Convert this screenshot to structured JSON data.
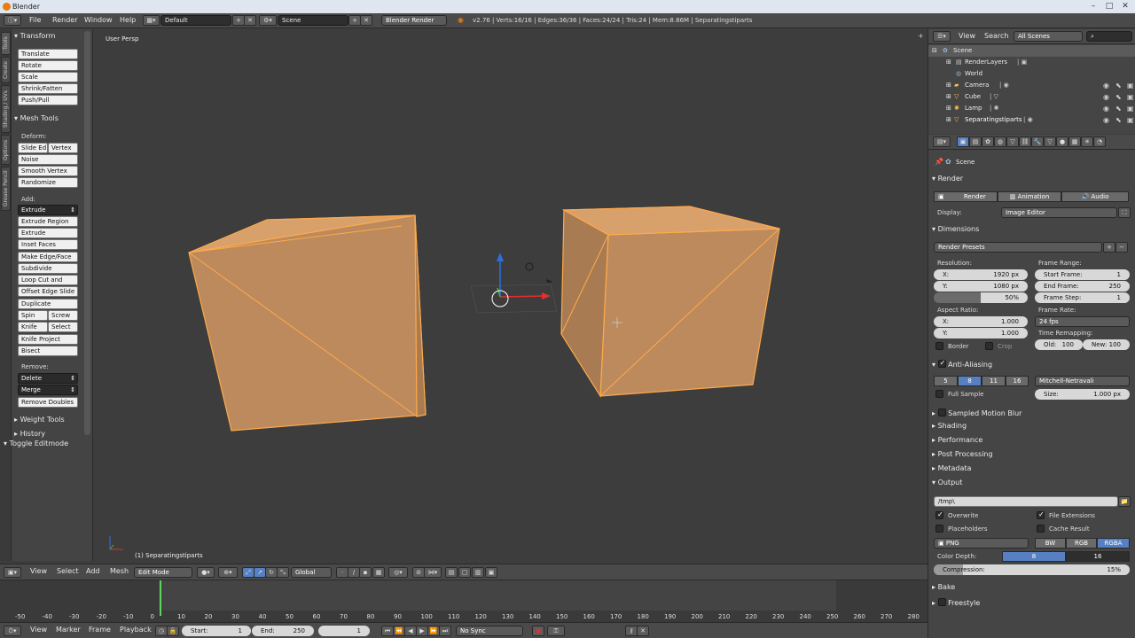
{
  "window": {
    "title": "Blender"
  },
  "topbar": {
    "menus": [
      "File",
      "Render",
      "Window",
      "Help"
    ],
    "layout": "Default",
    "scene": "Scene",
    "engine": "Blender Render",
    "stats": "v2.76 | Verts:16/16 | Edges:36/36 | Faces:24/24 | Tris:24 | Mem:8.86M | Separatingstiparts"
  },
  "toolshelf": {
    "tabs": [
      "Tools",
      "Create",
      "Shading / UVs",
      "Options",
      "Grease Pencil"
    ],
    "transform_title": "Transform",
    "transform": [
      "Translate",
      "Rotate",
      "Scale",
      "Shrink/Fatten",
      "Push/Pull"
    ],
    "mesh_tools_title": "Mesh Tools",
    "deform_label": "Deform:",
    "slide_edge": "Slide Ed",
    "vertex": "Vertex",
    "noise": "Noise",
    "smooth_vertex": "Smooth Vertex",
    "randomize": "Randomize",
    "add_label": "Add:",
    "extrude": "Extrude",
    "extrude_region": "Extrude Region",
    "extrude_individual": "Extrude Individual",
    "inset_faces": "Inset Faces",
    "make_edge_face": "Make Edge/Face",
    "subdivide": "Subdivide",
    "loop_cut": "Loop Cut and Slide",
    "offset_edge": "Offset Edge Slide",
    "duplicate": "Duplicate",
    "spin": "Spin",
    "screw": "Screw",
    "knife": "Knife",
    "select": "Select",
    "knife_project": "Knife Project",
    "bisect": "Bisect",
    "remove_label": "Remove:",
    "delete": "Delete",
    "merge": "Merge",
    "remove_doubles": "Remove Doubles",
    "weight_tools": "Weight Tools",
    "history": "History",
    "toggle_editmode": "Toggle Editmode"
  },
  "viewport": {
    "view_label": "User Persp",
    "object_label": "(1) Separatingstiparts",
    "mesh_color": "#f5a85a"
  },
  "vheader": {
    "view": "View",
    "select": "Select",
    "add": "Add",
    "mesh": "Mesh",
    "mode": "Edit Mode",
    "orientation": "Global"
  },
  "timeline": {
    "ticks": [
      "-50",
      "-40",
      "-30",
      "-20",
      "-10",
      "0",
      "10",
      "20",
      "30",
      "40",
      "50",
      "60",
      "70",
      "80",
      "90",
      "100",
      "110",
      "120",
      "130",
      "140",
      "150",
      "160",
      "170",
      "180",
      "190",
      "200",
      "210",
      "220",
      "230",
      "240",
      "250",
      "260",
      "270",
      "280"
    ],
    "current_frame": 1,
    "header": {
      "view": "View",
      "marker": "Marker",
      "frame": "Frame",
      "playback": "Playback",
      "start_label": "Start:",
      "start": "1",
      "end_label": "End:",
      "end": "250",
      "current": "1",
      "sync": "No Sync"
    }
  },
  "outliner": {
    "view": "View",
    "search": "Search",
    "filter": "All Scenes",
    "items": [
      {
        "label": "Scene"
      },
      {
        "label": "RenderLayers"
      },
      {
        "label": "World"
      },
      {
        "label": "Camera"
      },
      {
        "label": "Cube"
      },
      {
        "label": "Lamp"
      },
      {
        "label": "Separatingstiparts"
      }
    ]
  },
  "properties": {
    "breadcrumb": "Scene",
    "render_title": "Render",
    "render_btn": "Render",
    "animation_btn": "Animation",
    "audio_btn": "Audio",
    "display_label": "Display:",
    "display_value": "Image Editor",
    "dimensions_title": "Dimensions",
    "render_presets": "Render Presets",
    "resolution_label": "Resolution:",
    "res_x_label": "X:",
    "res_x": "1920 px",
    "res_y_label": "Y:",
    "res_y": "1080 px",
    "res_pct": "50%",
    "frame_range_label": "Frame Range:",
    "start_frame_label": "Start Frame:",
    "start_frame": "1",
    "end_frame_label": "End Frame:",
    "end_frame": "250",
    "frame_step_label": "Frame Step:",
    "frame_step": "1",
    "aspect_label": "Aspect Ratio:",
    "aspect_x_label": "X:",
    "aspect_x": "1.000",
    "aspect_y_label": "Y:",
    "aspect_y": "1.000",
    "frame_rate_label": "Frame Rate:",
    "frame_rate": "24 fps",
    "time_remap_label": "Time Remapping:",
    "old_label": "Old:",
    "old": "100",
    "new_label": "New:",
    "new": "100",
    "border": "Border",
    "crop": "Crop",
    "aa_title": "Anti-Aliasing",
    "aa_samples": [
      "5",
      "8",
      "11",
      "16"
    ],
    "aa_filter": "Mitchell-Netravali",
    "full_sample": "Full Sample",
    "size_label": "Size:",
    "size": "1.000 px",
    "smb_title": "Sampled Motion Blur",
    "shading": "Shading",
    "performance": "Performance",
    "post_processing": "Post Processing",
    "metadata": "Metadata",
    "output_title": "Output",
    "output_path": "/tmp\\",
    "overwrite": "Overwrite",
    "file_extensions": "File Extensions",
    "placeholders": "Placeholders",
    "cache_result": "Cache Result",
    "format": "PNG",
    "bw": "BW",
    "rgb": "RGB",
    "rgba": "RGBA",
    "color_depth_label": "Color Depth:",
    "depth_8": "8",
    "depth_16": "16",
    "compression_label": "Compression:",
    "compression": "15%",
    "compression_fraction": 0.15,
    "bake": "Bake",
    "freestyle": "Freestyle"
  }
}
